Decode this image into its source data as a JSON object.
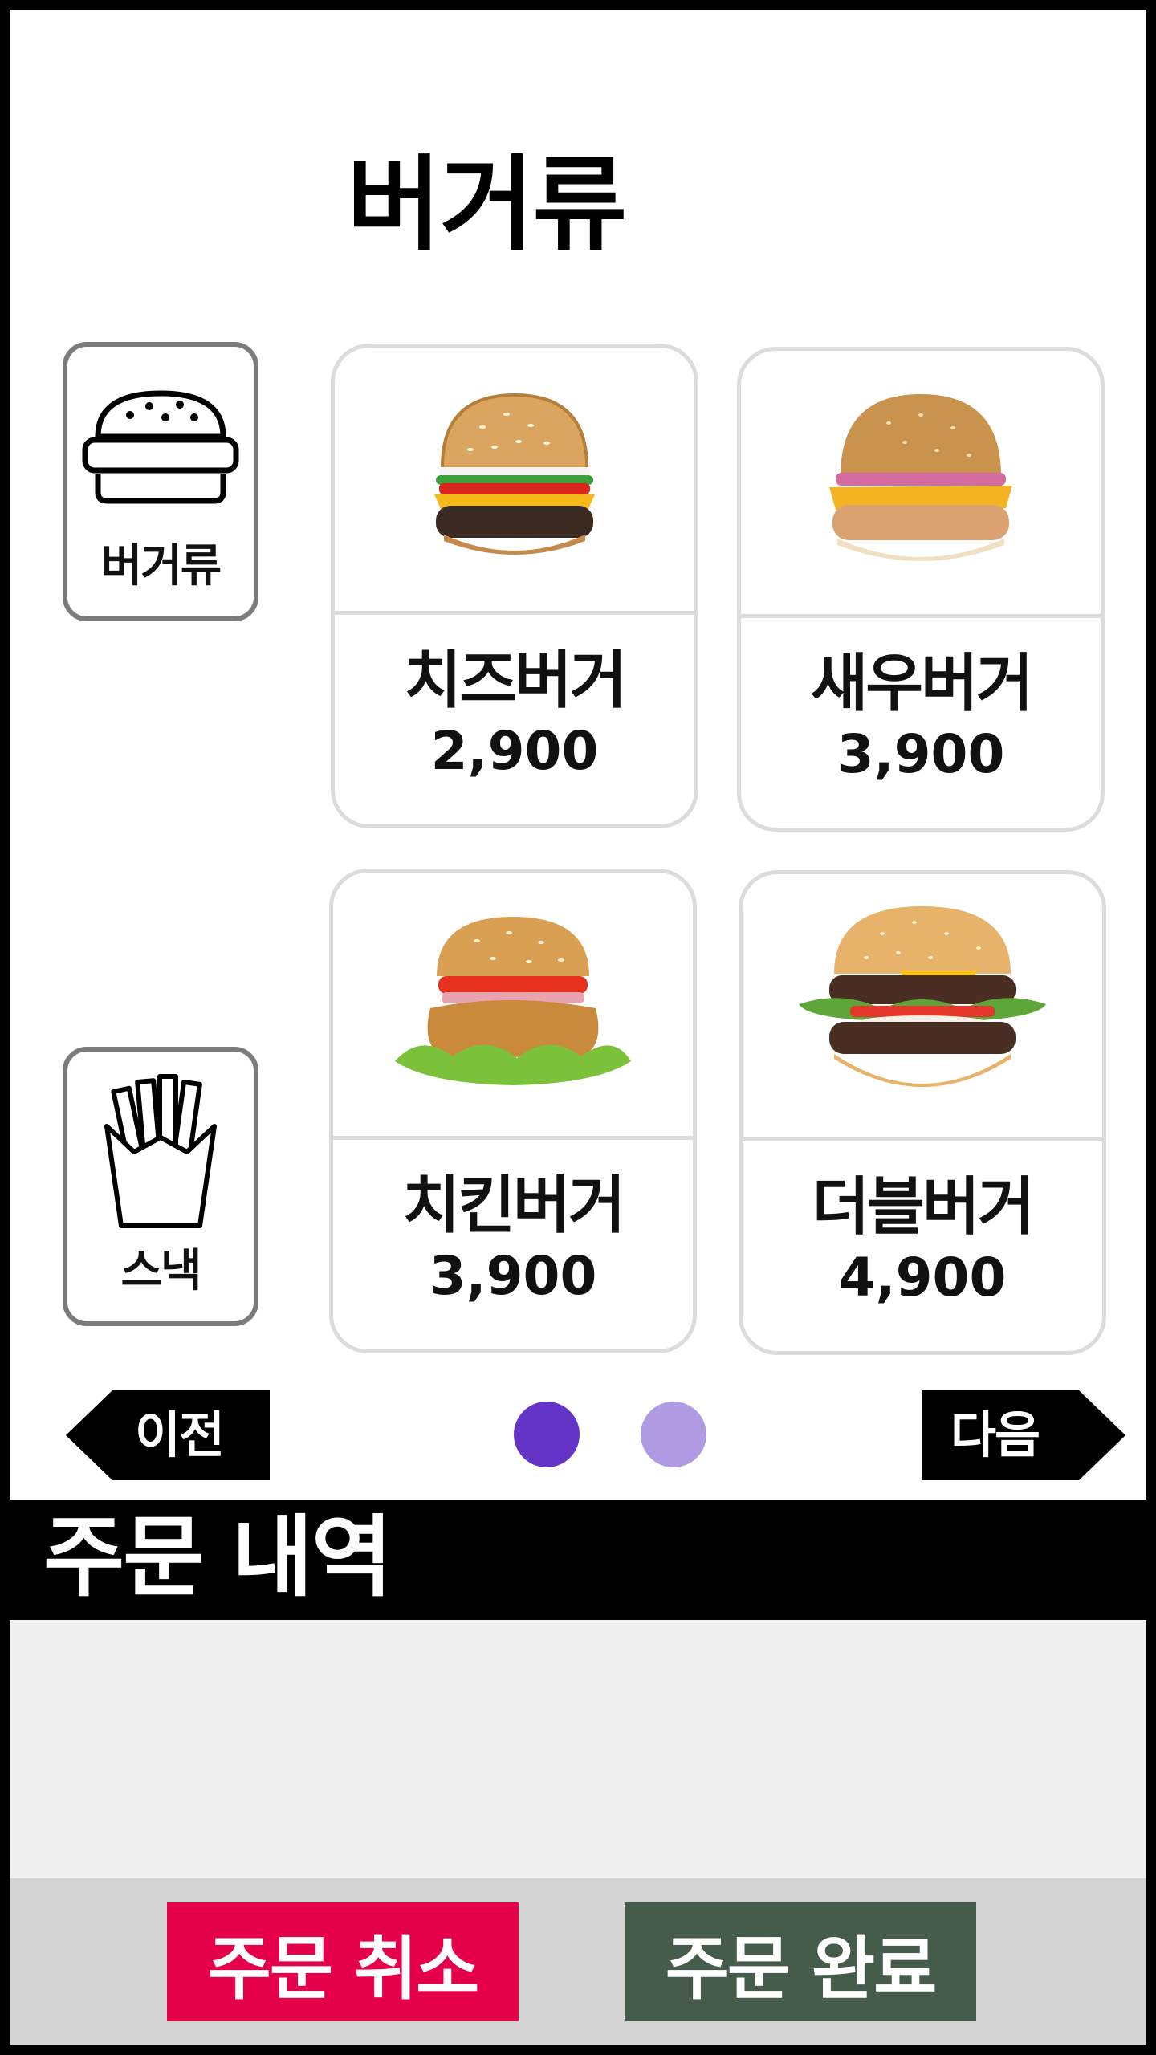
{
  "page": {
    "title": "버거류"
  },
  "categories": [
    {
      "label": "버거류",
      "icon": "burger-icon"
    },
    {
      "label": "스낵",
      "icon": "fries-icon"
    }
  ],
  "menu": [
    {
      "name": "치즈버거",
      "price": "2,900",
      "image": "cheeseburger-image"
    },
    {
      "name": "새우버거",
      "price": "3,900",
      "image": "shrimp-burger-image"
    },
    {
      "name": "치킨버거",
      "price": "3,900",
      "image": "chicken-burger-image"
    },
    {
      "name": "더블버거",
      "price": "4,900",
      "image": "double-burger-image"
    }
  ],
  "pager": {
    "prev_label": "이전",
    "next_label": "다음",
    "page_count": 2,
    "current_page": 1
  },
  "order": {
    "title": "주문 내역",
    "items": [],
    "cancel_label": "주문 취소",
    "complete_label": "주문 완료"
  },
  "colors": {
    "dot_active": "#6434c9",
    "dot_inactive": "#b09ae2",
    "cancel": "#e5004a",
    "complete": "#455c4a",
    "order_header": "#000000",
    "order_list_bg": "#f0f0f0",
    "footer_bg": "#d4d4d4"
  }
}
